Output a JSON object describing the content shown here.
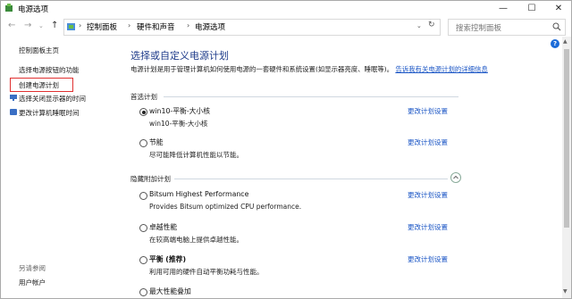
{
  "window": {
    "title": "电源选项",
    "minimize": "—",
    "maximize": "☐",
    "close": "✕"
  },
  "address": {
    "crumbs": [
      "控制面板",
      "硬件和声音",
      "电源选项"
    ],
    "search_placeholder": "搜索控制面板"
  },
  "sidebar": {
    "home": "控制面板主页",
    "items": [
      {
        "label": "选择电源按钮的功能"
      },
      {
        "label": "创建电源计划"
      },
      {
        "label": "选择关闭显示器的时间"
      },
      {
        "label": "更改计算机睡眠时间"
      }
    ],
    "see_also": "另请参阅",
    "user_accounts": "用户帐户"
  },
  "main": {
    "title": "选择或自定义电源计划",
    "desc": "电源计划是用于管理计算机如何使用电源的一套硬件和系统设置(如显示器亮度、睡眠等)。",
    "desc_link": "告诉我有关电源计划的详细信息",
    "preferred_label": "首选计划",
    "hidden_label": "隐藏附加计划",
    "change_label": "更改计划设置",
    "plans": [
      {
        "name": "win10-平衡-大小核",
        "desc": "win10-平衡-大小核",
        "selected": true
      },
      {
        "name": "节能",
        "desc": "尽可能降低计算机性能以节能。",
        "selected": false
      }
    ],
    "hidden_plans": [
      {
        "name": "Bitsum Highest Performance",
        "desc": "Provides Bitsum optimized CPU performance.",
        "selected": false
      },
      {
        "name": "卓越性能",
        "desc": "在较高端电脑上提供卓越性能。",
        "selected": false
      },
      {
        "name": "平衡 (推荐)",
        "desc": "利用可用的硬件自动平衡功耗与性能。",
        "selected": false
      },
      {
        "name": "最大性能叠加",
        "desc": "",
        "selected": false
      }
    ]
  },
  "colors": {
    "link": "#1a55c5",
    "heading": "#1e3b8a",
    "highlight_box": "#e03030"
  }
}
